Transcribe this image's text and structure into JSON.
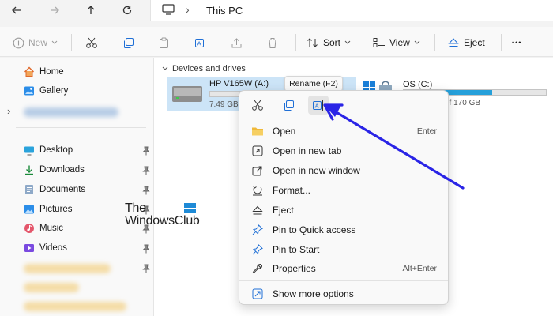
{
  "address": {
    "back_icon": "arrow-left-icon",
    "forward_icon": "arrow-right-icon",
    "up_icon": "arrow-up-icon",
    "refresh_icon": "refresh-icon",
    "computer_icon": "monitor-icon",
    "separator": "›",
    "location": "This PC"
  },
  "toolbar": {
    "new_label": "New",
    "sort_label": "Sort",
    "view_label": "View",
    "eject_label": "Eject",
    "more_glyph": "•••"
  },
  "sidebar": {
    "home": "Home",
    "gallery": "Gallery",
    "expand_glyph": "›",
    "pinned": [
      {
        "label": "Desktop",
        "icon": "desktop-icon"
      },
      {
        "label": "Downloads",
        "icon": "download-icon"
      },
      {
        "label": "Documents",
        "icon": "documents-icon"
      },
      {
        "label": "Pictures",
        "icon": "pictures-icon"
      },
      {
        "label": "Music",
        "icon": "music-icon"
      },
      {
        "label": "Videos",
        "icon": "videos-icon"
      }
    ]
  },
  "main": {
    "section_title": "Devices and drives",
    "drive_a": {
      "name": "HP V165W (A:)",
      "free": "7.49 GB"
    },
    "drive_c": {
      "name": "OS (C:)",
      "free": "of 170 GB",
      "usage_fraction": 0.62
    }
  },
  "tooltip": "Rename (F2)",
  "context_menu": {
    "items": [
      {
        "label": "Open",
        "shortcut": "Enter",
        "icon": "folder-icon"
      },
      {
        "label": "Open in new tab",
        "shortcut": "",
        "icon": "new-tab-icon"
      },
      {
        "label": "Open in new window",
        "shortcut": "",
        "icon": "new-window-icon"
      },
      {
        "label": "Format...",
        "shortcut": "",
        "icon": "format-icon"
      },
      {
        "label": "Eject",
        "shortcut": "",
        "icon": "eject-icon"
      },
      {
        "label": "Pin to Quick access",
        "shortcut": "",
        "icon": "pin-icon"
      },
      {
        "label": "Pin to Start",
        "shortcut": "",
        "icon": "pin-icon"
      },
      {
        "label": "Properties",
        "shortcut": "Alt+Enter",
        "icon": "wrench-icon"
      }
    ],
    "more_options": "Show more options"
  },
  "watermark": {
    "line1": "The",
    "line2": "WindowsClub"
  },
  "colors": {
    "accent": "#1f5fd6",
    "arrow": "#2a24e6",
    "selection": "#cce4f7",
    "drive_fill": "#26a0da"
  }
}
